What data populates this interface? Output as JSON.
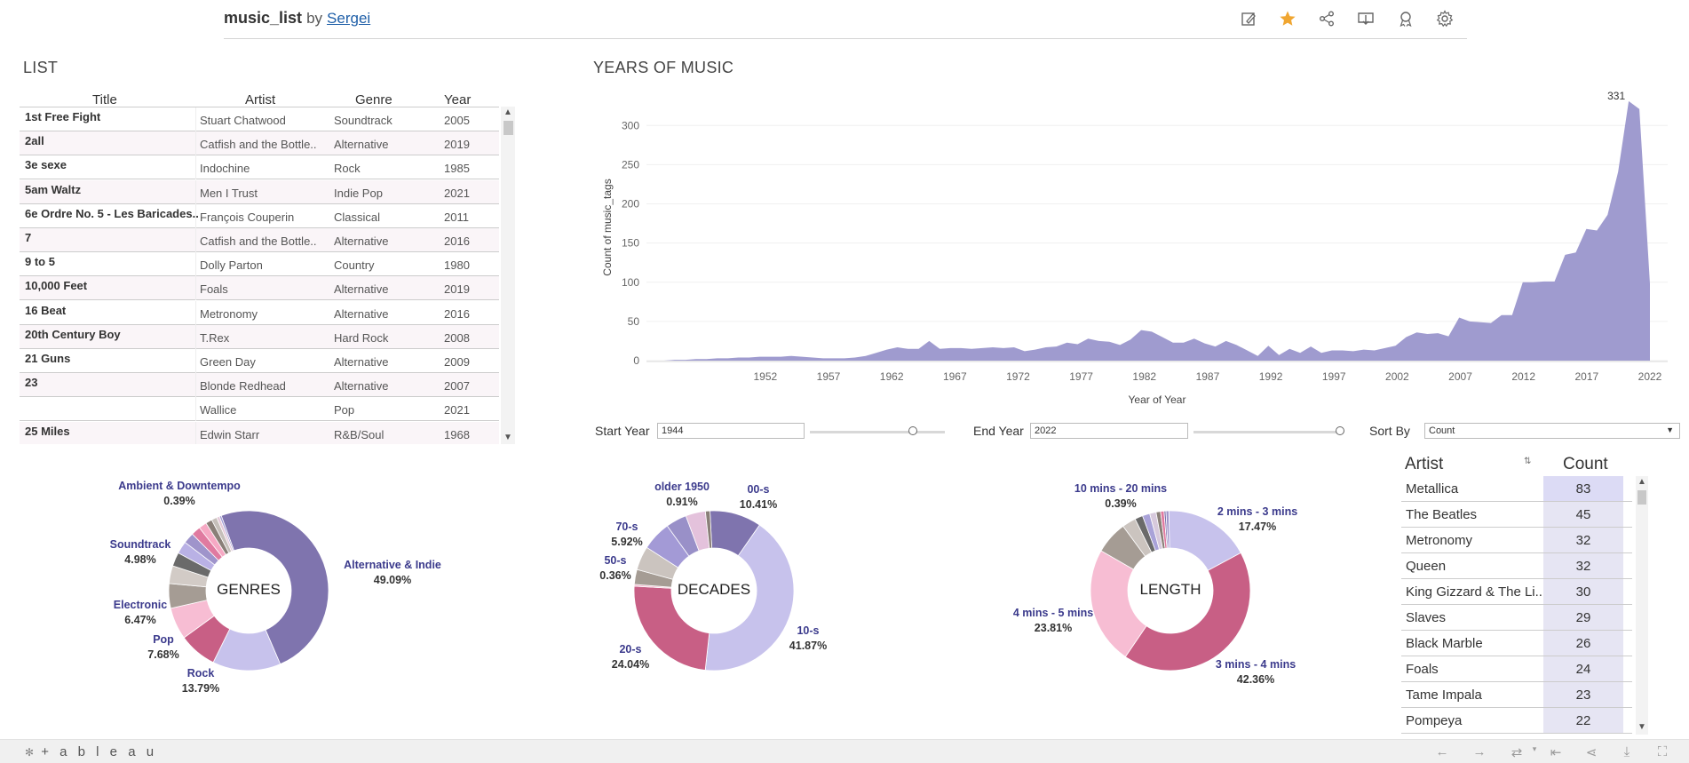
{
  "header": {
    "workbook": "music_list",
    "by": "by",
    "author": "Sergei"
  },
  "toolbar": {
    "icons": [
      "edit-icon",
      "star-icon",
      "share-icon",
      "download-icon",
      "metrics-icon",
      "gear-icon"
    ]
  },
  "list": {
    "title": "LIST",
    "columns": [
      "Title",
      "Artist",
      "Genre",
      "Year"
    ],
    "rows": [
      [
        "1st Free Fight",
        "Stuart Chatwood",
        "Soundtrack",
        "2005"
      ],
      [
        "2all",
        "Catfish and the Bottle..",
        "Alternative",
        "2019"
      ],
      [
        "3e sexe",
        "Indochine",
        "Rock",
        "1985"
      ],
      [
        "5am Waltz",
        "Men I Trust",
        "Indie Pop",
        "2021"
      ],
      [
        "6e Ordre No. 5 - Les Baricades..",
        "François Couperin",
        "Classical",
        "2011"
      ],
      [
        "7",
        "Catfish and the Bottle..",
        "Alternative",
        "2016"
      ],
      [
        "9 to 5",
        "Dolly Parton",
        "Country",
        "1980"
      ],
      [
        "10,000 Feet",
        "Foals",
        "Alternative",
        "2019"
      ],
      [
        "16 Beat",
        "Metronomy",
        "Alternative",
        "2016"
      ],
      [
        "20th Century Boy",
        "T.Rex",
        "Hard Rock",
        "2008"
      ],
      [
        "21 Guns",
        "Green Day",
        "Alternative",
        "2009"
      ],
      [
        "23",
        "Blonde Redhead",
        "Alternative",
        "2007"
      ],
      [
        "",
        "Wallice",
        "Pop",
        "2021"
      ],
      [
        "25 Miles",
        "Edwin Starr",
        "R&B/Soul",
        "1968"
      ]
    ]
  },
  "years": {
    "title": "YEARS OF MUSIC",
    "peak_label": "331"
  },
  "chart_data": {
    "type": "area",
    "title": "YEARS OF MUSIC",
    "xlabel": "Year of Year",
    "ylabel": "Count of music_tags",
    "xlim": [
      1944,
      2022
    ],
    "ylim": [
      0,
      340
    ],
    "xticks": [
      1952,
      1957,
      1962,
      1967,
      1972,
      1977,
      1982,
      1987,
      1992,
      1997,
      2002,
      2007,
      2012,
      2017,
      2022
    ],
    "yticks": [
      0,
      50,
      100,
      150,
      200,
      250,
      300
    ],
    "color": "#9f9bcf",
    "x": [
      1944,
      1945,
      1946,
      1947,
      1948,
      1949,
      1950,
      1951,
      1952,
      1953,
      1954,
      1955,
      1956,
      1957,
      1958,
      1959,
      1960,
      1961,
      1962,
      1963,
      1964,
      1965,
      1966,
      1967,
      1968,
      1969,
      1970,
      1971,
      1972,
      1973,
      1974,
      1975,
      1976,
      1977,
      1978,
      1979,
      1980,
      1981,
      1982,
      1983,
      1984,
      1985,
      1986,
      1987,
      1988,
      1989,
      1990,
      1991,
      1992,
      1993,
      1994,
      1995,
      1996,
      1997,
      1998,
      1999,
      2000,
      2001,
      2002,
      2003,
      2004,
      2005,
      2006,
      2007,
      2008,
      2009,
      2010,
      2011,
      2012,
      2013,
      2014,
      2015,
      2016,
      2017,
      2018,
      2019,
      2020,
      2021,
      2022
    ],
    "y": [
      0,
      1,
      1,
      2,
      2,
      3,
      3,
      4,
      4,
      5,
      5,
      5,
      6,
      5,
      4,
      3,
      3,
      3,
      4,
      6,
      10,
      14,
      17,
      15,
      15,
      25,
      15,
      16,
      16,
      15,
      16,
      17,
      16,
      17,
      12,
      14,
      17,
      18,
      23,
      21,
      28,
      25,
      24,
      20,
      27,
      39,
      37,
      30,
      23,
      23,
      28,
      22,
      18,
      25,
      20,
      13,
      6,
      19,
      7,
      15,
      10,
      18,
      10,
      13,
      13,
      12,
      14,
      13,
      16,
      19,
      30,
      36,
      34,
      35,
      31,
      55,
      50,
      49,
      48,
      58,
      58,
      100,
      100,
      101,
      101,
      135,
      138,
      168,
      166,
      186,
      241,
      331,
      321,
      98
    ],
    "annotation": {
      "x": 2020,
      "y": 331,
      "text": "331"
    }
  },
  "controls": {
    "start_label": "Start Year",
    "start_value": "1944",
    "end_label": "End Year",
    "end_value": "2022",
    "sort_label": "Sort By",
    "sort_value": "Count",
    "start_slider_fraction": 0.76,
    "end_slider_fraction": 1.0
  },
  "donuts": [
    {
      "name": "GENRES",
      "slices": [
        {
          "label": "Alternative & Indie",
          "pct": 49.09,
          "color": "#7f74ae",
          "labelled": true
        },
        {
          "label": "Rock",
          "pct": 13.79,
          "color": "#c7c2ec",
          "labelled": true
        },
        {
          "label": "Pop",
          "pct": 7.68,
          "color": "#c85f85",
          "labelled": true
        },
        {
          "label": "Electronic",
          "pct": 6.47,
          "color": "#f7bdd3",
          "labelled": true
        },
        {
          "label": "Soundtrack",
          "pct": 4.98,
          "color": "#a59c94",
          "labelled": true
        },
        {
          "label": "",
          "pct": 3.6,
          "color": "#d2cbc6",
          "labelled": false
        },
        {
          "label": "",
          "pct": 2.8,
          "color": "#6a6a6a",
          "labelled": false
        },
        {
          "label": "",
          "pct": 2.5,
          "color": "#b9b1e5",
          "labelled": false
        },
        {
          "label": "",
          "pct": 2.2,
          "color": "#9f94cb",
          "labelled": false
        },
        {
          "label": "",
          "pct": 1.9,
          "color": "#e07aa0",
          "labelled": false
        },
        {
          "label": "",
          "pct": 1.6,
          "color": "#f6a9c4",
          "labelled": false
        },
        {
          "label": "",
          "pct": 1.3,
          "color": "#8a7f78",
          "labelled": false
        },
        {
          "label": "",
          "pct": 1.1,
          "color": "#c6bfba",
          "labelled": false
        },
        {
          "label": "",
          "pct": 0.6,
          "color": "#e5c9d8",
          "labelled": false
        },
        {
          "label": "Ambient & Downtempo",
          "pct": 0.39,
          "color": "#a09ad4",
          "labelled": true
        }
      ]
    },
    {
      "name": "DECADES",
      "slices": [
        {
          "label": "00-s",
          "pct": 10.41,
          "color": "#7f74ae",
          "labelled": true
        },
        {
          "label": "10-s",
          "pct": 41.87,
          "color": "#c7c2ec",
          "labelled": true
        },
        {
          "label": "20-s",
          "pct": 24.04,
          "color": "#c85f85",
          "labelled": true
        },
        {
          "label": "50-s",
          "pct": 0.36,
          "color": "#efb1c7",
          "labelled": true
        },
        {
          "label": "",
          "pct": 3.0,
          "color": "#a59c94",
          "labelled": false
        },
        {
          "label": "",
          "pct": 4.8,
          "color": "#cbc4bf",
          "labelled": false
        },
        {
          "label": "70-s",
          "pct": 5.92,
          "color": "#a39ad6",
          "labelled": true
        },
        {
          "label": "",
          "pct": 4.2,
          "color": "#9990c8",
          "labelled": false
        },
        {
          "label": "",
          "pct": 4.0,
          "color": "#e4c2dc",
          "labelled": false
        },
        {
          "label": "older 1950",
          "pct": 0.91,
          "color": "#8a7f78",
          "labelled": true
        }
      ]
    },
    {
      "name": "LENGTH",
      "slices": [
        {
          "label": "2 mins - 3 mins",
          "pct": 17.47,
          "color": "#c7c2ec",
          "labelled": true
        },
        {
          "label": "3 mins - 4 mins",
          "pct": 42.36,
          "color": "#c85f85",
          "labelled": true
        },
        {
          "label": "4 mins - 5 mins",
          "pct": 23.81,
          "color": "#f7bdd3",
          "labelled": true
        },
        {
          "label": "",
          "pct": 6.6,
          "color": "#a59c94",
          "labelled": false
        },
        {
          "label": "",
          "pct": 2.8,
          "color": "#cbc4bf",
          "labelled": false
        },
        {
          "label": "",
          "pct": 1.6,
          "color": "#6a6a6a",
          "labelled": false
        },
        {
          "label": "",
          "pct": 1.5,
          "color": "#a9a2d8",
          "labelled": false
        },
        {
          "label": "",
          "pct": 1.3,
          "color": "#d7c9dc",
          "labelled": false
        },
        {
          "label": "",
          "pct": 0.9,
          "color": "#8a7f78",
          "labelled": false
        },
        {
          "label": "",
          "pct": 0.7,
          "color": "#e07aa0",
          "labelled": false
        },
        {
          "label": "10 mins - 20 mins",
          "pct": 0.39,
          "color": "#7f74ae",
          "labelled": true
        },
        {
          "label": "",
          "pct": 0.57,
          "color": "#9f94cb",
          "labelled": false
        }
      ]
    }
  ],
  "artists": {
    "col_artist": "Artist",
    "col_count": "Count",
    "rows": [
      [
        "Metallica",
        "83"
      ],
      [
        "The Beatles",
        "45"
      ],
      [
        "Metronomy",
        "32"
      ],
      [
        "Queen",
        "32"
      ],
      [
        "King Gizzard & The Li..",
        "30"
      ],
      [
        "Slaves",
        "29"
      ],
      [
        "Black Marble",
        "26"
      ],
      [
        "Foals",
        "24"
      ],
      [
        "Tame Impala",
        "23"
      ],
      [
        "Pompeya",
        "22"
      ]
    ]
  },
  "footer": {
    "logo": "+ a b l e a u"
  }
}
